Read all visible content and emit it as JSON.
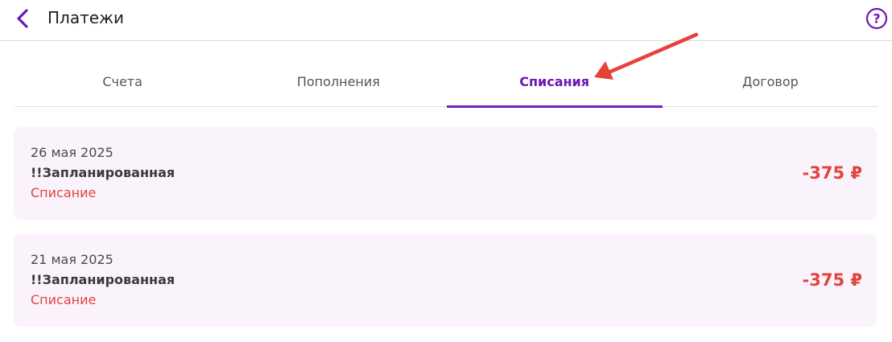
{
  "header": {
    "title": "Платежи",
    "back_icon": "chevron-left-icon",
    "help_icon": "question-circle-icon",
    "accent_color": "#6c17b5"
  },
  "tabs": [
    {
      "label": "Счета",
      "active": false
    },
    {
      "label": "Пополнения",
      "active": false
    },
    {
      "label": "Списания",
      "active": true
    },
    {
      "label": "Договор",
      "active": false
    }
  ],
  "annotation": {
    "icon": "red-arrow-pointing-to-tab",
    "color": "#e8413c"
  },
  "transactions": [
    {
      "date": "26 мая 2025",
      "name": "!!Запланированная",
      "type": "Списание",
      "amount": "-375 ₽"
    },
    {
      "date": "21 мая 2025",
      "name": "!!Запланированная",
      "type": "Списание",
      "amount": "-375 ₽"
    }
  ],
  "colors": {
    "card_background": "#fbf3fb",
    "debit_red": "#e0443e",
    "active_tab_underline": "#7b1fbd"
  }
}
